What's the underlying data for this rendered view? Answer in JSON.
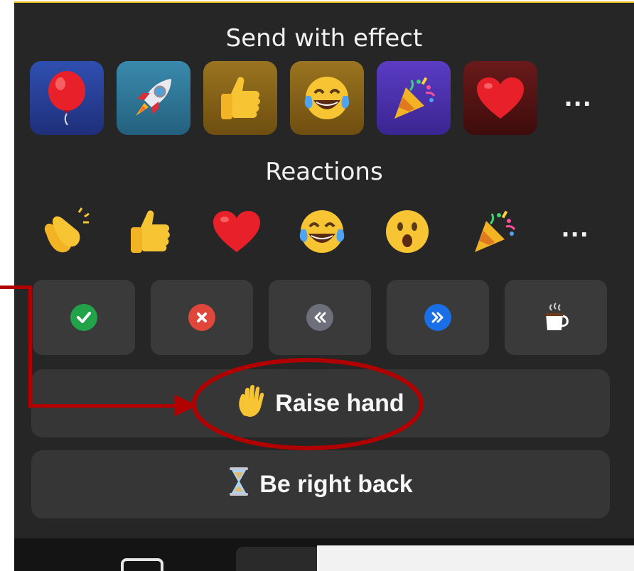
{
  "send_with_effect": {
    "title": "Send with effect",
    "effects": [
      {
        "icon": "balloon-icon",
        "bg": "#2a3f9a"
      },
      {
        "icon": "rocket-icon",
        "bg": "#2d6f8c"
      },
      {
        "icon": "thumbs-up-icon",
        "bg": "#8a6418"
      },
      {
        "icon": "tears-of-joy-icon",
        "bg": "#8a6418"
      },
      {
        "icon": "party-popper-icon",
        "bg": "#4b2fa0"
      },
      {
        "icon": "heart-icon",
        "bg": "#5a1414"
      }
    ],
    "more_label": "..."
  },
  "reactions": {
    "title": "Reactions",
    "items": [
      {
        "icon": "clapping-hands-icon"
      },
      {
        "icon": "thumbs-up-icon"
      },
      {
        "icon": "heart-icon"
      },
      {
        "icon": "tears-of-joy-icon"
      },
      {
        "icon": "open-mouth-icon"
      },
      {
        "icon": "party-popper-icon"
      }
    ],
    "more_label": "..."
  },
  "status_buttons": [
    {
      "icon": "yes-check-icon",
      "color": "#22a34a",
      "glyph": "✓"
    },
    {
      "icon": "no-x-icon",
      "color": "#e0463a",
      "glyph": "×"
    },
    {
      "icon": "slow-down-icon",
      "color": "#6d6f7a",
      "glyph": "«"
    },
    {
      "icon": "speed-up-icon",
      "color": "#1a6ee6",
      "glyph": "»"
    },
    {
      "icon": "coffee-icon",
      "color": "#ffffff",
      "glyph": "☕"
    }
  ],
  "raise_hand": {
    "label": "Raise hand",
    "icon": "raised-hand-icon",
    "glyph": "✋"
  },
  "be_right_back": {
    "label": "Be right back",
    "icon": "hourglass-icon",
    "glyph": "⌛"
  },
  "colors": {
    "highlight": "#b00000",
    "panel": "#262626",
    "accent_top": "#f0c419"
  }
}
